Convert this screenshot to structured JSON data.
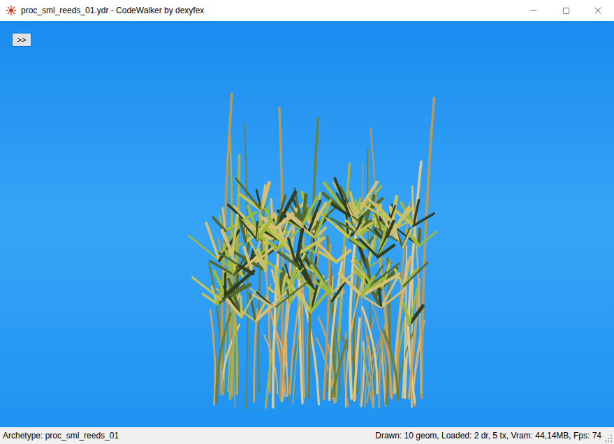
{
  "window": {
    "title": "proc_sml_reeds_01.ydr - CodeWalker by dexyfex"
  },
  "toolbar": {
    "toggle_button": ">>"
  },
  "status_bar": {
    "left": "Archetype: proc_sml_reeds_01",
    "right": "Drawn: 10 geom, Loaded: 2 dr, 5 tx, Vram: 44,14MB, Fps: 74"
  }
}
